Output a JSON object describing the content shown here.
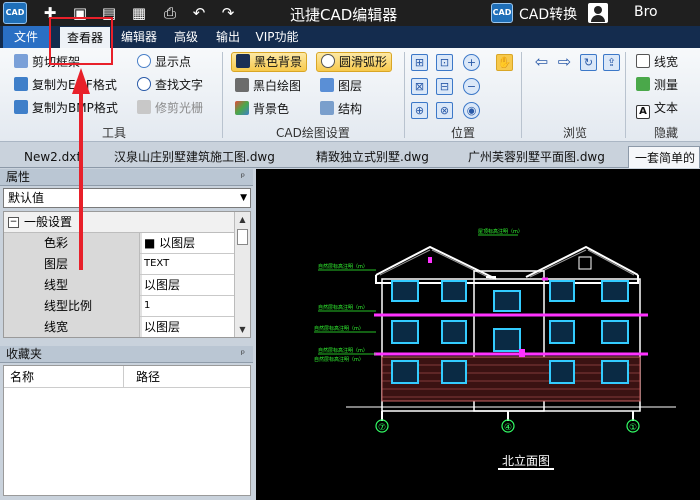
{
  "window": {
    "title": "迅捷CAD编辑器",
    "app_logo": "CAD",
    "quick_access": [
      "plus-icon",
      "folder-icon",
      "save-icon",
      "save-as-icon",
      "print-icon",
      "undo-icon",
      "redo-icon"
    ],
    "cad_badge": "CAD",
    "cad_convert": "CAD转换",
    "user_name": "Bro"
  },
  "menu_tabs": [
    {
      "label": "文件",
      "active": false
    },
    {
      "label": "查看器",
      "active": true
    },
    {
      "label": "编辑器",
      "active": false
    },
    {
      "label": "高级",
      "active": false
    },
    {
      "label": "输出",
      "active": false
    },
    {
      "label": "VIP功能",
      "active": false
    }
  ],
  "ribbon": {
    "tools_group": {
      "label": "工具",
      "items": [
        "剪切框架",
        "复制为EMF格式",
        "复制为BMP格式",
        "显示点",
        "查找文字",
        "修剪光栅"
      ]
    },
    "cad_settings_group": {
      "label": "CAD绘图设置",
      "items": [
        "黑色背景",
        "黑白绘图",
        "背景色",
        "圆滑弧形",
        "图层",
        "结构"
      ]
    },
    "position_group": {
      "label": "位置"
    },
    "browse_group": {
      "label": "浏览"
    },
    "hide_group": {
      "label": "隐藏",
      "items": [
        "线宽",
        "测量",
        "文本"
      ]
    }
  },
  "doc_tabs": [
    {
      "label": "New2.dxf",
      "active": false
    },
    {
      "label": "汉泉山庄别墅建筑施工图.dwg",
      "active": false
    },
    {
      "label": "精致独立式别墅.dwg",
      "active": false
    },
    {
      "label": "广州芙蓉别墅平面图.dwg",
      "active": false
    },
    {
      "label": "一套简单的",
      "active": true
    }
  ],
  "properties_panel": {
    "title": "属性",
    "pin": "ᵖ",
    "dropdown_value": "默认值",
    "section": "一般设置",
    "collapse_symbol": "−",
    "rows": [
      {
        "key": "色彩",
        "value": "■ 以图层"
      },
      {
        "key": "图层",
        "value": "TEXT"
      },
      {
        "key": "线型",
        "value": "以图层"
      },
      {
        "key": "线型比例",
        "value": "1"
      },
      {
        "key": "线宽",
        "value": "以图层"
      }
    ]
  },
  "favorites_panel": {
    "title": "收藏夹",
    "pin": "ᵖ",
    "columns": [
      "名称",
      "路径"
    ]
  },
  "drawing": {
    "title": "北立面图",
    "axis_labels": [
      "⑦",
      "④",
      "①"
    ],
    "annotations": [
      "自然层标高注明（m）",
      "自然层标高注明（m）",
      "自然层标高注明（m）",
      "自然层标高注明（m）",
      "自然层标高注明（m）",
      "屋顶标高注明（m）"
    ],
    "colors": {
      "wall": "#ffffff",
      "window": "#33ccff",
      "band": "#ff33ff",
      "text": "#33ff33",
      "axis": "#33ff66",
      "brick": "#c86464"
    }
  },
  "colors": {
    "accent": "#2a6fc4",
    "highlight": "#e8202a"
  }
}
